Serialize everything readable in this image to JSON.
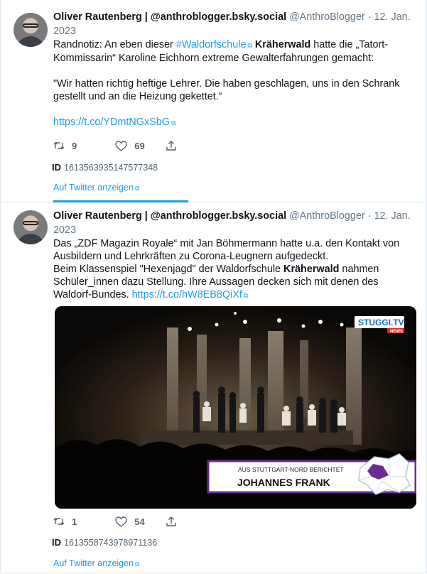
{
  "tweets": [
    {
      "name": "Oliver Rautenberg | @anthroblogger.bsky.social",
      "handle": "@AnthroBlogger",
      "separator": "·",
      "date": "12. Jan. 2023",
      "text": {
        "l1_a": "Randnotiz: An eben dieser ",
        "l1_link": "#Waldorfschule",
        "l1_b": " ",
        "l1_bold": "Kräherwald",
        "l1_c": " hatte die „Tatort-Kommissarin“ Karoline Eichhorn extreme Gewalterfahrungen gemacht:",
        "quote": "\"Wir hatten richtig heftige Lehrer. Die haben geschlagen, uns in den Schrank gestellt und an die Heizung gekettet.“",
        "url": "https://t.co/YDmtNGxSbG"
      },
      "retweets": "9",
      "likes": "69",
      "id_label": "ID",
      "id_value": "1613563935147577348",
      "view_link": "Auf Twitter anzeigen"
    },
    {
      "name": "Oliver Rautenberg | @anthroblogger.bsky.social",
      "handle": "@AnthroBlogger",
      "separator": "·",
      "date": "12. Jan. 2023",
      "text": {
        "p1": "Das „ZDF Magazin Royale“ mit Jan Böhmermann hatte u.a. den Kontakt von Ausbildern und Lehrkräften zu Corona-Leugnern aufgedeckt.",
        "p2_a": "Beim Klassenspiel \"Hexenjagd\" der Waldorfschule ",
        "p2_bold": "Kräherwald",
        "p2_b": " nahmen Schüler_innen dazu Stellung. Ihre Aussagen decken sich mit denen des Waldorf-Bundes. ",
        "url": "https://t.co/hW8EB8QiXf"
      },
      "media": {
        "logo_text": "STUGGI.TV",
        "logo_sub": "NEWS",
        "lower_third_small": "AUS STUTTGART-NORD BERICHTET",
        "lower_third_big": "JOHANNES FRANK"
      },
      "retweets": "1",
      "likes": "54",
      "id_label": "ID",
      "id_value": "1613558743978971136",
      "view_link": "Auf Twitter anzeigen"
    }
  ],
  "colors": {
    "link": "#1d9bf0",
    "muted": "#536471",
    "border": "#e1e8ed",
    "accent_purple": "#6a2c91"
  },
  "icons": [
    "retweet-icon",
    "like-icon",
    "share-icon",
    "external-link-icon"
  ]
}
